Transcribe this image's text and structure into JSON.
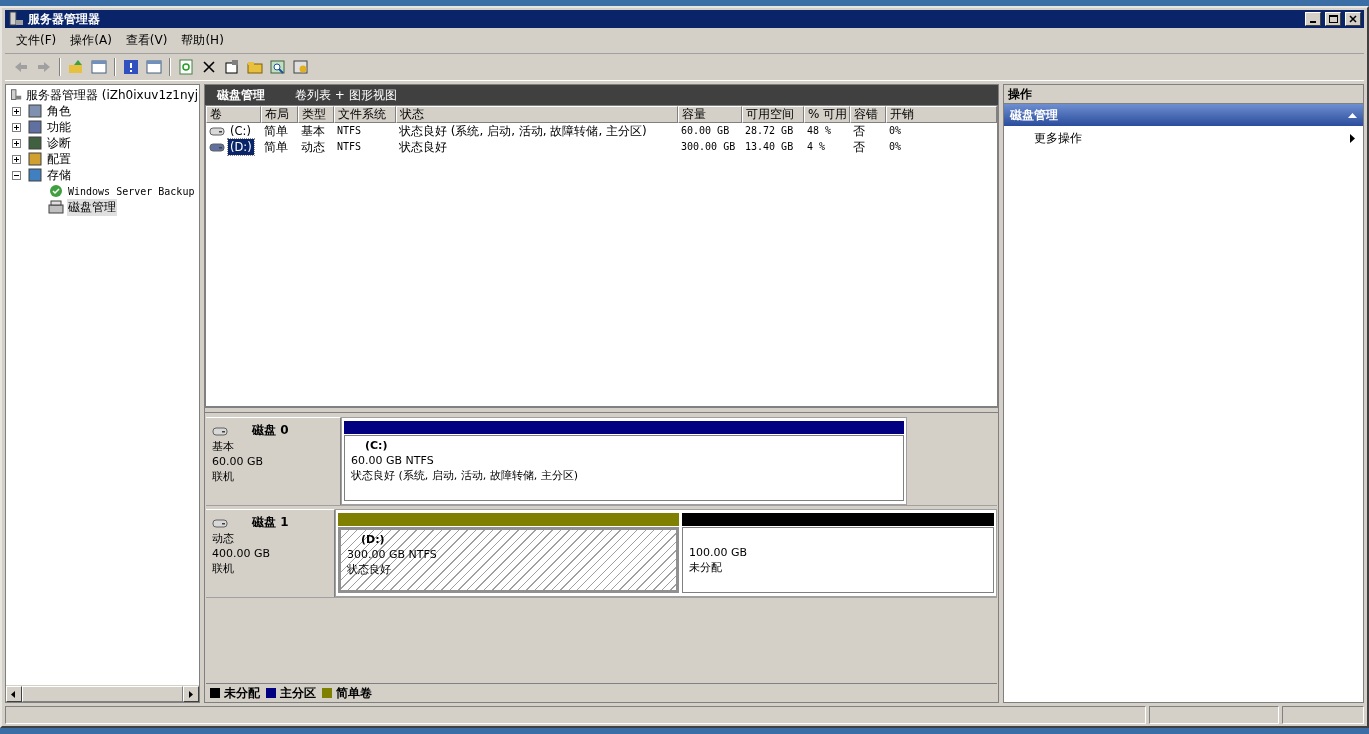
{
  "window": {
    "title": "服务器管理器"
  },
  "menu": [
    "文件(F)",
    "操作(A)",
    "查看(V)",
    "帮助(H)"
  ],
  "tree": {
    "label": "服务器管理器 (iZh0ixuv1z1nyj",
    "selected": false,
    "children": [
      {
        "label": "角色",
        "expanded": false,
        "selected": false
      },
      {
        "label": "功能",
        "expanded": false,
        "selected": false
      },
      {
        "label": "诊断",
        "expanded": false,
        "selected": false
      },
      {
        "label": "配置",
        "expanded": false,
        "selected": false
      },
      {
        "label": "存储",
        "expanded": true,
        "selected": false,
        "children": [
          {
            "label": "Windows Server Backup",
            "selected": false
          },
          {
            "label": "磁盘管理",
            "selected": true
          }
        ]
      }
    ]
  },
  "center": {
    "title": "磁盘管理",
    "subtitle": "卷列表 + 图形视图"
  },
  "volumes": {
    "columns": [
      "卷",
      "布局",
      "类型",
      "文件系统",
      "状态",
      "容量",
      "可用空间",
      "% 可用",
      "容错",
      "开销"
    ],
    "rows": [
      {
        "selected": false,
        "cells": [
          "(C:)",
          "简单",
          "基本",
          "NTFS",
          "状态良好 (系统, 启动, 活动, 故障转储, 主分区)",
          "60.00 GB",
          "28.72 GB",
          "48 %",
          "否",
          "0%"
        ]
      },
      {
        "selected": true,
        "cells": [
          "(D:)",
          "简单",
          "动态",
          "NTFS",
          "状态良好",
          "300.00 GB",
          "13.40 GB",
          "4 %",
          "否",
          "0%"
        ]
      }
    ]
  },
  "disks": [
    {
      "name": "磁盘 0",
      "type": "基本",
      "size": "60.00 GB",
      "status": "联机",
      "partitions": [
        {
          "label": "(C:)",
          "size": "60.00 GB NTFS",
          "status": "状态良好 (系统, 启动, 活动, 故障转储, 主分区)",
          "color": "#000080",
          "selected": false
        }
      ]
    },
    {
      "name": "磁盘 1",
      "type": "动态",
      "size": "400.00 GB",
      "status": "联机",
      "partitions": [
        {
          "label": "(D:)",
          "size": "300.00 GB NTFS",
          "status": "状态良好",
          "color": "#808000",
          "selected": true
        },
        {
          "size": "100.00 GB",
          "status": "未分配",
          "color": "#000000",
          "selected": false
        }
      ]
    }
  ],
  "legend": [
    {
      "label": "未分配",
      "color": "#000000"
    },
    {
      "label": "主分区",
      "color": "#000080"
    },
    {
      "label": "简单卷",
      "color": "#808000"
    }
  ],
  "actions": {
    "title": "操作",
    "section": "磁盘管理",
    "items": [
      "更多操作"
    ]
  }
}
